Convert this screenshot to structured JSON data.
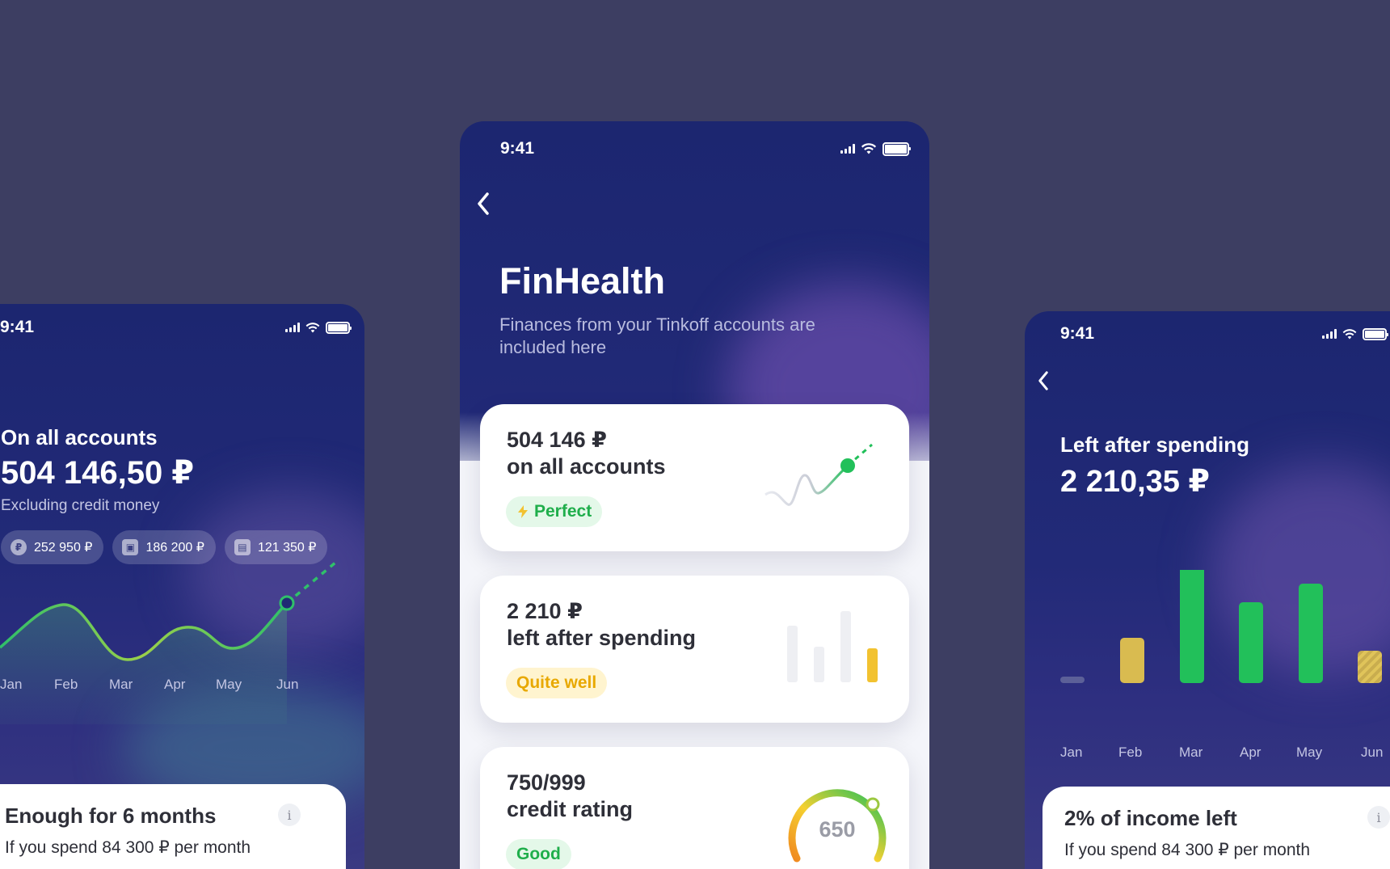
{
  "status_time": "9:41",
  "center": {
    "title": "FinHealth",
    "subtitle": "Finances from your Tinkoff accounts are included here",
    "cards": [
      {
        "amount": "504 146 ₽",
        "desc": "on all accounts",
        "status": "Perfect"
      },
      {
        "amount": "2 210 ₽",
        "desc": "left after spending",
        "status": "Quite well"
      },
      {
        "amount": "750/999",
        "desc": "credit rating",
        "status": "Good",
        "gauge_value": "650"
      }
    ]
  },
  "left": {
    "label": "On all accounts",
    "amount": "504 146,50 ₽",
    "sub": "Excluding credit money",
    "chips": [
      {
        "icon": "ruble-coin-icon",
        "value": "252 950 ₽"
      },
      {
        "icon": "safe-icon",
        "value": "186 200 ₽"
      },
      {
        "icon": "briefcase-icon",
        "value": "121 350 ₽"
      }
    ],
    "months": [
      "Jan",
      "Feb",
      "Mar",
      "Apr",
      "May",
      "Jun"
    ],
    "info_title": "Enough for 6 months",
    "info_text": "If you spend 84 300 ₽ per month"
  },
  "right": {
    "label": "Left after spending",
    "amount": "2 210,35 ₽",
    "months": [
      "Jan",
      "Feb",
      "Mar",
      "Apr",
      "May",
      "Jun"
    ],
    "info_title": "2% of income left",
    "info_text": "If you spend 84 300 ₽ per month"
  },
  "colors": {
    "green": "#22c05a",
    "yellow": "#e3c050",
    "gauge_start": "#f0a020"
  }
}
